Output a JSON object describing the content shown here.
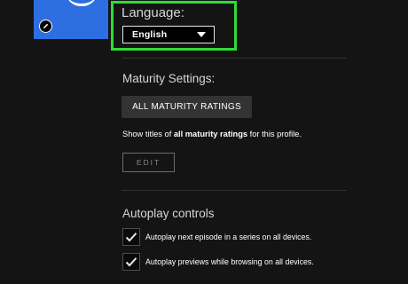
{
  "profile": {
    "avatar_icon": "smile-avatar-icon",
    "edit_icon": "pencil-icon"
  },
  "language": {
    "label": "Language:",
    "selected": "English",
    "highlight_color": "#2fdc35"
  },
  "maturity": {
    "heading": "Maturity Settings:",
    "button_label": "ALL MATURITY RATINGS",
    "desc_before": "Show titles of ",
    "desc_bold": "all maturity ratings",
    "desc_after": " for this profile.",
    "edit_label": "EDIT"
  },
  "autoplay": {
    "heading": "Autoplay controls",
    "options": [
      {
        "label": "Autoplay next episode in a series on all devices.",
        "checked": true
      },
      {
        "label": "Autoplay previews while browsing on all devices.",
        "checked": true
      }
    ]
  }
}
